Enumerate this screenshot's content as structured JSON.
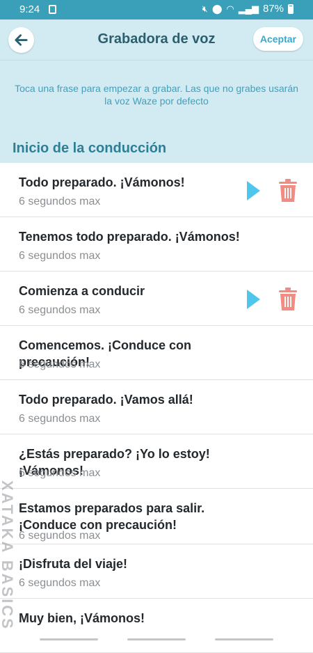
{
  "status_bar": {
    "time": "9:24",
    "battery": "87%",
    "icons": [
      "notification-icon",
      "mute-icon",
      "location-icon",
      "wifi-icon",
      "signal-icon",
      "battery-icon"
    ]
  },
  "header": {
    "title": "Grabadora de voz",
    "accept_label": "Aceptar"
  },
  "info": {
    "instruction": "Toca una frase para empezar a grabar. Las que no grabes usarán la voz Waze por defecto",
    "section_title": "Inicio de la conducción"
  },
  "phrases": [
    {
      "text": "Todo preparado. ¡Vámonos!",
      "limit": "6 segundos max",
      "recorded": true
    },
    {
      "text": "Tenemos todo preparado. ¡Vámonos!",
      "limit": "6 segundos max",
      "recorded": false
    },
    {
      "text": "Comienza a conducir",
      "limit": "6 segundos max",
      "recorded": true
    },
    {
      "text": "Comencemos. ¡Conduce con precaución!",
      "limit": "6 segundos max",
      "recorded": false
    },
    {
      "text": "Todo preparado. ¡Vamos allá!",
      "limit": "6 segundos max",
      "recorded": false
    },
    {
      "text": "¿Estás preparado? ¡Yo lo estoy! ¡Vámonos!",
      "limit": "6 segundos max",
      "recorded": false
    },
    {
      "text": "Estamos preparados para salir. ¡Conduce con precaución!",
      "limit": "6 segundos max",
      "recorded": false
    },
    {
      "text": "¡Disfruta del viaje!",
      "limit": "6 segundos max",
      "recorded": false
    },
    {
      "text": "Muy bien, ¡Vámonos!",
      "limit": "",
      "recorded": false
    }
  ],
  "watermark": "XATAKA BASICS",
  "colors": {
    "status_bar": "#3a9fb8",
    "header_bg": "#d2eaf1",
    "title": "#2c5f6e",
    "accent": "#3aa7c9",
    "section_title": "#2d7f96",
    "play": "#4fc6ec",
    "trash": "#f28b82"
  }
}
